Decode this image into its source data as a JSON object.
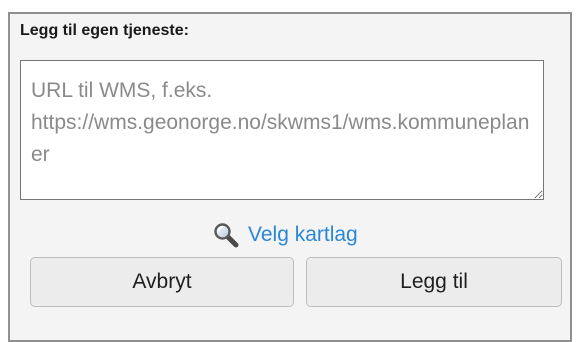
{
  "dialog": {
    "heading": "Legg til egen tjeneste:",
    "url_input": {
      "value": "",
      "placeholder": "URL til WMS, f.eks. https://wms.geonorge.no/skwms1/wms.kommuneplaner"
    },
    "select_layer_link": {
      "icon": "magnifier-icon",
      "label": "Velg kartlag"
    },
    "buttons": {
      "cancel_label": "Avbryt",
      "add_label": "Legg til"
    }
  },
  "colors": {
    "panel_background": "#f4f4f4",
    "panel_border": "#909090",
    "link": "#2a87d6",
    "button_background": "#ececec",
    "placeholder": "#8a8a8a"
  }
}
